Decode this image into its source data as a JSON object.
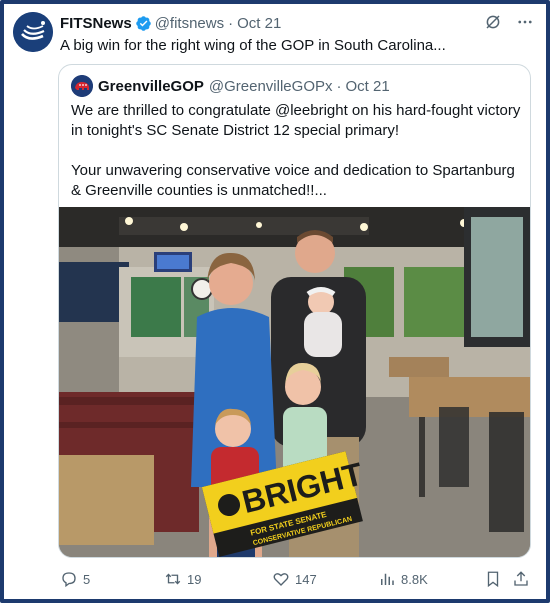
{
  "author": {
    "name": "FITSNews",
    "handle": "@fitsnews",
    "date": "Oct 21",
    "avatar_icon": "fitsnews-logo-icon"
  },
  "tweet": {
    "text": "A big win for the right wing of the GOP in South Carolina..."
  },
  "quote": {
    "name": "GreenvilleGOP",
    "handle": "@GreenvilleGOPx",
    "date": "Oct 21",
    "paragraph1": "We are thrilled to congratulate @leebright on his hard-fought victory in tonight's SC Senate District 12 special primary!",
    "paragraph2": "Your unwavering conservative voice and dedication to Spartanburg & Greenville counties is unmatched!!...",
    "photo": {
      "sign_line1": "BRIGHT",
      "sign_line2": "FOR STATE SENATE",
      "sign_line3": "CONSERVATIVE REPUBLICAN"
    }
  },
  "actions": {
    "replies": "5",
    "reposts": "19",
    "likes": "147",
    "views": "8.8K"
  },
  "colors": {
    "verified": "#1d9bf0",
    "secondary_text": "#536471",
    "border": "#cfd9de",
    "frame": "#1d3a6e"
  }
}
